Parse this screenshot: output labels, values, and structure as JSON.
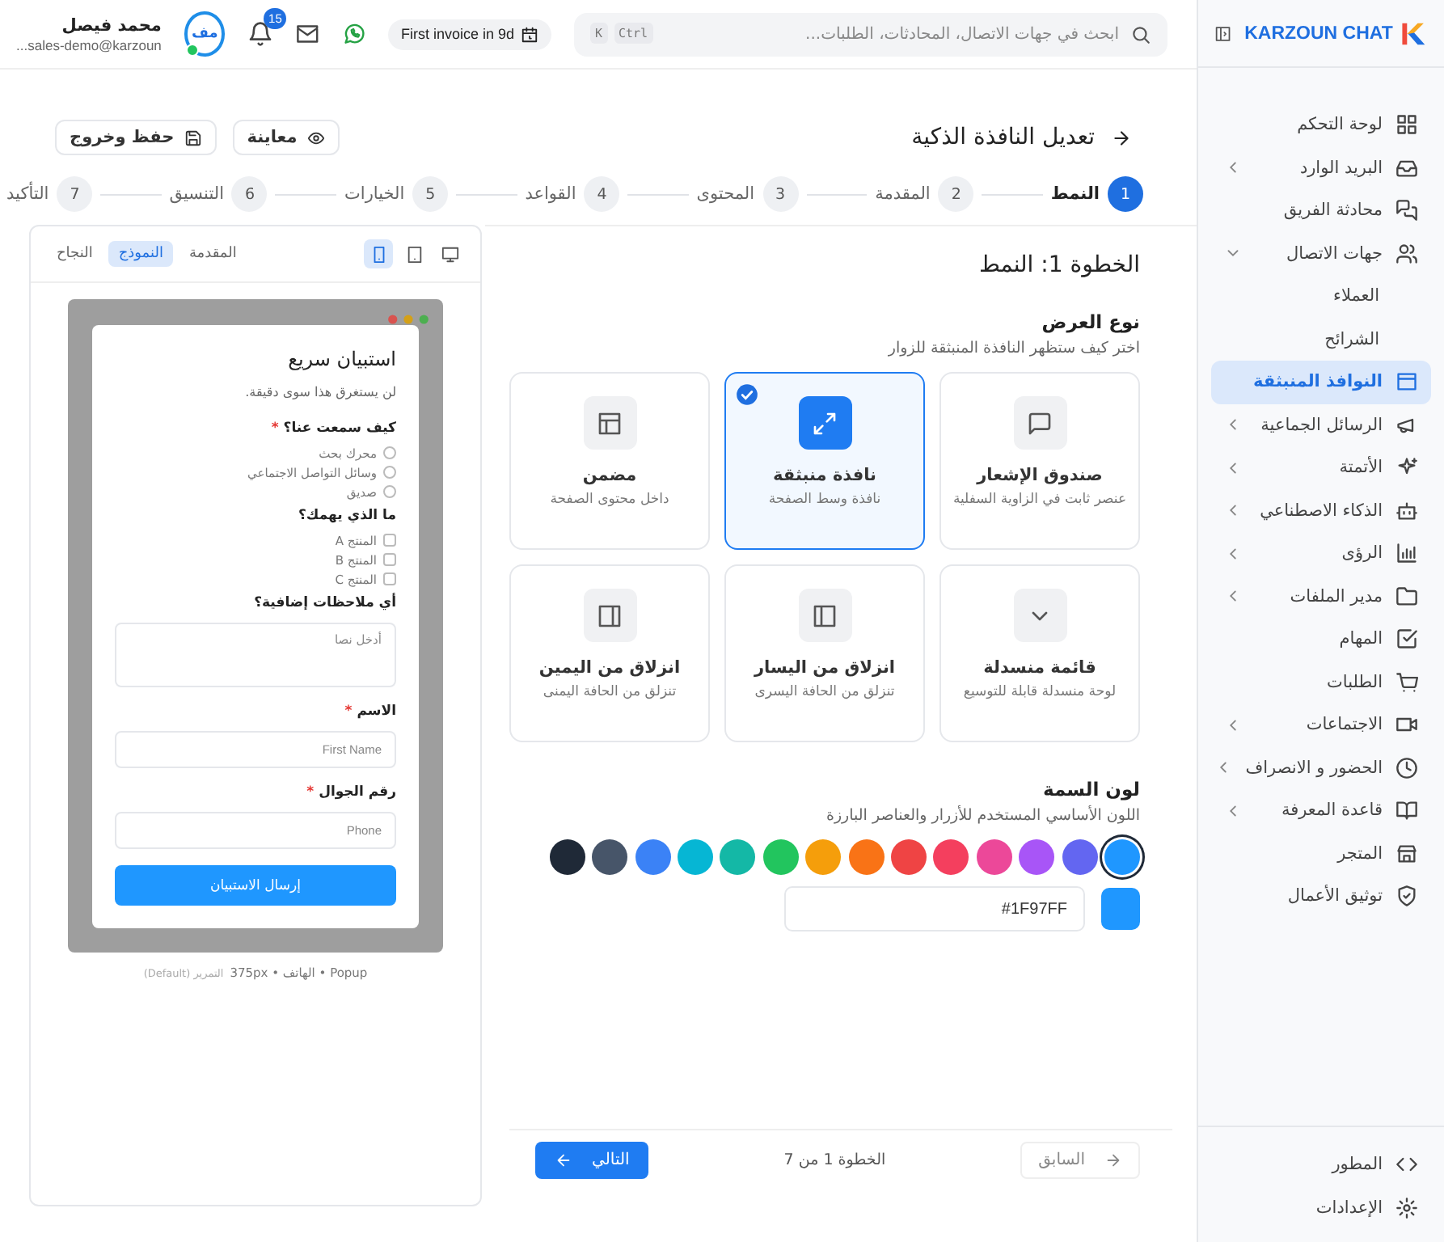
{
  "sidebar": {
    "brand": "KARZOUN CHAT",
    "items": [
      {
        "label": "لوحة التحكم",
        "selected": false
      },
      {
        "label": "البريد الوارد",
        "selected": false,
        "expanded": false
      },
      {
        "label": "محادثة الفريق",
        "selected": false
      },
      {
        "label": "جهات الاتصال",
        "selected": false,
        "expanded": true,
        "children": [
          {
            "label": "العملاء",
            "selected": false
          },
          {
            "label": "الشرائح",
            "selected": false
          }
        ]
      },
      {
        "label": "النوافذ المنبثقة",
        "selected": true
      },
      {
        "label": "الرسائل الجماعية",
        "selected": false,
        "expanded": false
      },
      {
        "label": "الأتمتة",
        "selected": false,
        "expanded": false
      },
      {
        "label": "الذكاء الاصطناعي",
        "selected": false,
        "expanded": false
      },
      {
        "label": "الرؤى",
        "selected": false,
        "expanded": false
      },
      {
        "label": "مدير الملفات",
        "selected": false,
        "expanded": false
      },
      {
        "label": "المهام",
        "selected": false
      },
      {
        "label": "الطلبات",
        "selected": false
      },
      {
        "label": "الاجتماعات",
        "selected": false,
        "expanded": false
      },
      {
        "label": "الحضور و الانصراف",
        "selected": false,
        "expanded": false
      },
      {
        "label": "قاعدة المعرفة",
        "selected": false,
        "expanded": false
      },
      {
        "label": "المتجر",
        "selected": false
      },
      {
        "label": "توثيق الأعمال",
        "selected": false
      }
    ],
    "footer_items": [
      {
        "label": "المطور",
        "selected": false
      },
      {
        "label": "الإعدادات",
        "selected": false
      }
    ]
  },
  "header": {
    "search": {
      "placeholder": "ابحث في جهات الاتصال، المحادثات، الطلبات...",
      "shortcut": [
        "Ctrl",
        "K"
      ]
    },
    "trial_badge": "First invoice in 9d",
    "notifications": "15",
    "user": {
      "initials": "مف",
      "name": "محمد فيصل",
      "email": "sales-demo@karzoun...",
      "online": true
    }
  },
  "page": {
    "title": "تعديل النافذة الذكية",
    "buttons": [
      "معاينة",
      "حفظ وخروج"
    ]
  },
  "steps": [
    {
      "number": "1",
      "label": "النمط",
      "selected": true
    },
    {
      "number": "2",
      "label": "المقدمة",
      "selected": false
    },
    {
      "number": "3",
      "label": "المحتوى",
      "selected": false
    },
    {
      "number": "4",
      "label": "القواعد",
      "selected": false
    },
    {
      "number": "5",
      "label": "الخيارات",
      "selected": false
    },
    {
      "number": "6",
      "label": "التنسيق",
      "selected": false
    },
    {
      "number": "7",
      "label": "التأكيد",
      "selected": false
    }
  ],
  "form": {
    "heading": "الخطوة 1: النمط",
    "display_type": {
      "title": "نوع العرض",
      "subtitle": "اختر كيف ستظهر النافذة المنبثقة للزوار",
      "options": [
        {
          "title": "صندوق الإشعار",
          "description": "عنصر ثابت في الزاوية السفلية",
          "selected": false
        },
        {
          "title": "نافذة منبثقة",
          "description": "نافذة وسط الصفحة",
          "selected": true
        },
        {
          "title": "مضمن",
          "description": "داخل محتوى الصفحة",
          "selected": false
        },
        {
          "title": "قائمة منسدلة",
          "description": "لوحة منسدلة قابلة للتوسيع",
          "selected": false
        },
        {
          "title": "انزلاق من اليسار",
          "description": "تنزلق من الحافة اليسرى",
          "selected": false
        },
        {
          "title": "انزلاق من اليمين",
          "description": "تنزلق من الحافة اليمنى",
          "selected": false
        }
      ]
    },
    "theme_color": {
      "title": "لون السمة",
      "subtitle": "اللون الأساسي المستخدم للأزرار والعناصر البارزة",
      "swatches": [
        {
          "color": "#1f97ff",
          "selected": true
        },
        {
          "color": "#6366f1",
          "selected": false
        },
        {
          "color": "#a855f7",
          "selected": false
        },
        {
          "color": "#ec4899",
          "selected": false
        },
        {
          "color": "#f43f5e",
          "selected": false
        },
        {
          "color": "#ef4444",
          "selected": false
        },
        {
          "color": "#f97316",
          "selected": false
        },
        {
          "color": "#f59e0b",
          "selected": false
        },
        {
          "color": "#22c55e",
          "selected": false
        },
        {
          "color": "#14b8a6",
          "selected": false
        },
        {
          "color": "#06b6d4",
          "selected": false
        },
        {
          "color": "#3b82f6",
          "selected": false
        },
        {
          "color": "#475569",
          "selected": false
        },
        {
          "color": "#1f2937",
          "selected": false
        }
      ],
      "value": "#1F97FF"
    }
  },
  "navigation": {
    "previous": {
      "label": "السابق",
      "disabled": true
    },
    "progress": "الخطوة 1 من 7",
    "next": {
      "label": "التالي",
      "disabled": false
    }
  },
  "preview": {
    "devices": [
      {
        "selected": false
      },
      {
        "selected": false
      },
      {
        "selected": true
      }
    ],
    "tabs": [
      {
        "label": "المقدمة",
        "selected": false
      },
      {
        "label": "النموذج",
        "selected": true
      },
      {
        "label": "النجاح",
        "selected": false
      }
    ],
    "survey": {
      "title": "استبيان سريع",
      "subtitle": "لن يستغرق هذا سوى دقيقة.",
      "questions": [
        {
          "kind": "radio",
          "label": "كيف سمعت عنا؟",
          "required_mark": "*",
          "options": [
            {
              "label": "محرك بحث",
              "checked": false
            },
            {
              "label": "وسائل التواصل الاجتماعي",
              "checked": false
            },
            {
              "label": "صديق",
              "checked": false
            }
          ]
        },
        {
          "kind": "checkbox",
          "label": "ما الذي يهمك؟",
          "options": [
            {
              "label": "المنتج A",
              "checked": false
            },
            {
              "label": "المنتج B",
              "checked": false
            },
            {
              "label": "المنتج C",
              "checked": false
            }
          ]
        },
        {
          "kind": "textarea",
          "label": "أي ملاحظات إضافية؟",
          "placeholder": "أدخل نصا"
        },
        {
          "kind": "text",
          "label": "الاسم",
          "required_mark": "*",
          "placeholder": "First Name"
        },
        {
          "kind": "text",
          "label": "رقم الجوال",
          "required_mark": "*",
          "placeholder": "Phone"
        }
      ],
      "submit": "إرسال الاستبيان"
    },
    "caption": "Popup • الهاتف • 375px",
    "caption_note": "التمرير (Default)"
  }
}
